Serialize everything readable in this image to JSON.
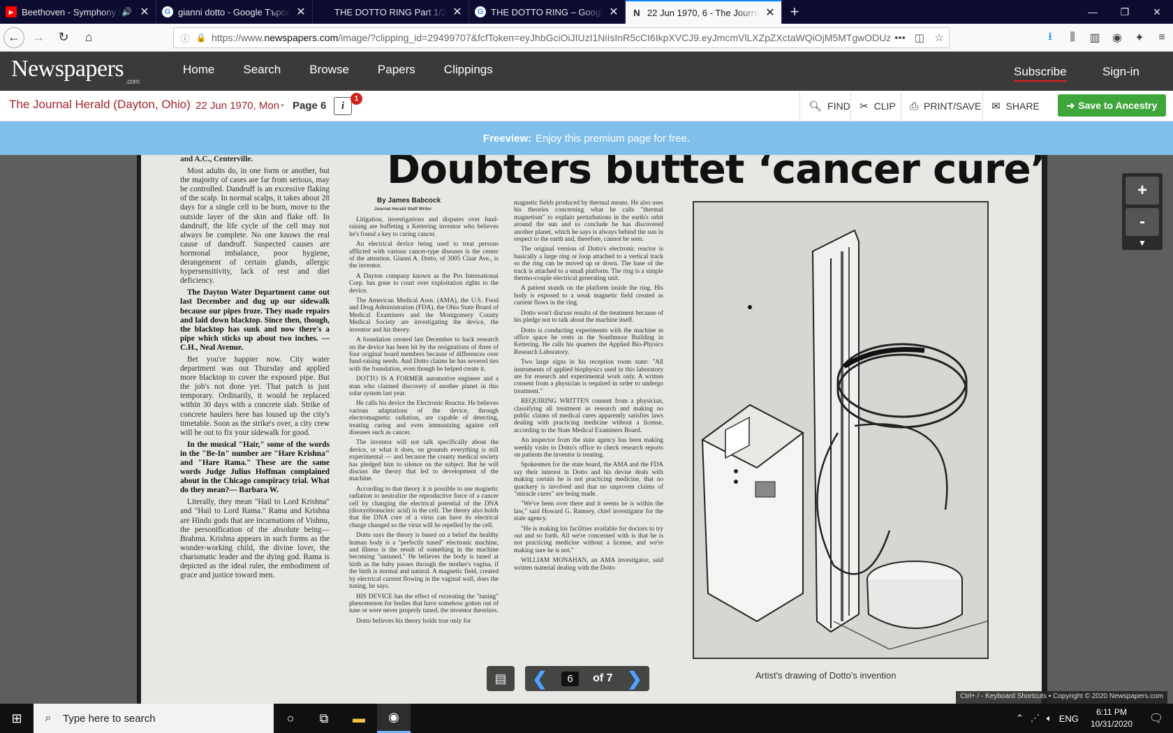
{
  "tabs": [
    {
      "title": "Beethoven - Symphony No.",
      "icon": "youtube-icon"
    },
    {
      "title": "gianni dotto - Google Търсене",
      "icon": "google-icon"
    },
    {
      "title": "THE DOTTO RING Part 1/2 - New",
      "icon": "tab-icon"
    },
    {
      "title": "THE DOTTO RING – Google Търс",
      "icon": "google-icon"
    },
    {
      "title": "22 Jun 1970, 6 - The Journal Her",
      "icon": "newspapers-icon"
    }
  ],
  "address": {
    "prefix": "https://www.",
    "domain": "newspapers.com",
    "path": "/image/?clipping_id=29499707&fcfToken=eyJhbGciOiJIUzI1NiIsInR5cCI6IkpXVCJ9.eyJmcmVlLXZpZXctaWQiOjM5MTgwODUzNy"
  },
  "site": {
    "logo": "Newspapers",
    "logo_suffix": ".com",
    "nav": [
      "Home",
      "Search",
      "Browse",
      "Papers",
      "Clippings"
    ],
    "subscribe": "Subscribe",
    "signin": "Sign-in"
  },
  "paper": {
    "name": "The Journal Herald (Dayton, Ohio)",
    "date": "22 Jun 1970, Mon",
    "page": "Page 6",
    "info_label": "i",
    "badge": "1",
    "find": "FIND",
    "clip": "CLIP",
    "print": "PRINT/SAVE",
    "share": "SHARE",
    "ancestry": "Save to Ancestry"
  },
  "freeview": {
    "label": "Freeview:",
    "text": "Enjoy this premium page for free."
  },
  "article": {
    "col1_top": "and A.C., Centerville.",
    "col1": [
      "Most adults do, in one form or another, but the majority of cases are far from serious, may be controlled. Dandruff is an excessive flaking of the scalp. In normal scalps, it takes about 28 days for a single cell to be born, move to the outside layer of the skin and flake off. In dandruff, the life cycle of the cell may not always be complete. No one knows the real cause of dandruff. Suspected causes are hormonal imbalance, poor hygiene, derangement of certain glands, allergic hypersensitivity, lack of rest and diet deficiency.",
      "The Dayton Water Department came out last December and dug up our sidewalk because our pipes froze. They made repairs and laid down blacktop. Since then, though, the blacktop has sunk and now there's a pipe which sticks up about two inches. — C.H., Neal Avenue.",
      "Bet you're happier now. City water department was out Thursday and applied more blacktop to cover the exposed pipe. But the job's not done yet. That patch is just temporary. Ordinarily, it would be replaced within 30 days with a concrete slab. Strike of concrete haulers here has loused up the city's timetable. Soon as the strike's over, a city crew will be out to fix your sidewalk for good.",
      "In the musical \"Hair,\" some of the words in the \"Be-In\" number are \"Hare Krishna\" and \"Hare Rama.\" These are the same words Judge Julius Hoffman complained about in the Chicago conspiracy trial. What do they mean?— Barbara W.",
      "Literally, they mean \"Hail to Lord Krishna\" and \"Hail to Lord Rama.\" Rama and Krishna are Hindu gods that are incarnations of Vishnu, the personification of the absolute being— Brahma. Krishna appears in such forms as the wonder-working child, the divine lover, the charismatic leader and the dying god. Rama is depicted as the ideal ruler, the embodiment of grace and justice toward men."
    ],
    "headline": "Doubters buttet ‘cancer cure’",
    "byline": "By James Babcock",
    "byline_title": "Journal Herald Staff Writer",
    "col2": [
      "Litigation, investigations and disputes over fund-raising are buffeting a Kettering inventor who believes he's found a key to curing cancer.",
      "An electrical device being used to treat persons afflicted with various cancer-type diseases is the center of the attention. Gianni A. Dotto, of 3005 Claar Ave., is the inventor.",
      "A Dayton company known as the Pro International Corp. has gone to court over exploitation rights to the device.",
      "The American Medical Assn. (AMA), the U.S. Food and Drug Administration (FDA), the Ohio State Board of Medical Examiners and the Montgomery County Medical Society are investigating the device, the inventor and his theory.",
      "A foundation created last December to back research on the device has been hit by the resignations of three of four original board members because of differences over fund-raising needs. And Dotto claims he has severed ties with the foundation, even though he helped create it.",
      "DOTTO IS A FORMER automotive engineer and a man who claimed discovery of another planet in this solar system last year.",
      "He calls his device the Electronic Reactor. He believes various adaptations of the device, through electromagnetic radiation, are capable of detecting, treating curing and even immunizing against cell diseases such as cancer.",
      "The inventor will not talk specifically about the device, or what it does, on grounds everything is still experimental — and because the county medical society has pledged him to silence on the subject. But he will discuss the theory that led to development of the machine.",
      "According to that theory it is possible to use magnetic radiation to neutralize the reproductive force of a cancer cell by changing the electrical potential of the DNA (dioxyribonucleic acid) in the cell. The theory also holds that the DNA core of a virus can have its electrical charge changed so the virus will be repelled by the cell.",
      "Dotto says the theory is based on a belief the healthy human body is a \"perfectly tuned\" electronic machine, and illness is the result of something in the machine becoming \"untuned.\" He believes the body is tuned at birth as the baby passes through the mother's vagina, if the birth is normal and natural. A magnetic field, created by electrical current flowing in the vaginal wall, does the tuning, he says.",
      "HIS DEVICE has the effect of recreating the \"tuning\" phenomenon for bodies that have somehow gotten out of tune or were never properly tuned, the inventor theorizes.",
      "Dotto believes his theory holds true only for"
    ],
    "col3": [
      "magnetic fields produced by thermal means. He also uses his theories concerning what he calls \"thermal magnetism\" to explain perturbations in the earth's orbit around the sun and to conclude he has discovered another planet, which he says is always behind the sun in respect to the earth and, therefore, cannot be seen.",
      "The original version of Dotto's electronic reactor is basically a large ring or loop attached to a vertical track so the ring can be moved up or down. The base of the track is attached to a small platform. The ring is a simple thermo-couple electrical generating unit.",
      "A patient stands on the platform inside the ring. His body is exposed to a weak magnetic field created as current flows in the ring.",
      "Dotto won't discuss results of the treatment because of his pledge not to talk about the machine itself.",
      "Dotto is conducting experiments with the machine in office space he rents in the Southmoor Building in Kettering. He calls his quarters the Applied Bio-Physics Research Laboratory.",
      "Two large signs in his reception room state: \"All instruments of applied biophysics used in this laboratory are for research and experimental work only. A written consent from a physician is required in order to undergo treatment.\"",
      "REQUIRING WRITTEN consent from a physician, classifying all treatment as research and making no public claims of medical cures apparently satisfies laws dealing with practicing medicine without a license, according to the State Medical Examiners Board.",
      "An inspector from the state agency has been making weekly visits to Dotto's office to check research reports on patients the inventor is treating.",
      "Spokesmen for the state board, the AMA and the FDA say their interest in Dotto and his devise deals with making certain he is not practicing medicine, that no quackery is involved and that no unproven claims of \"miracle cures\" are being made.",
      "\"We've been over there and it seems he is within the law,\" said Howard G. Ramsey, chief investigator for the state agency.",
      "\"He is making his facilities available for doctors to try out and so forth. All we're concerned with is that he is not practicing medicine without a license, and we're making sure he is not.\"",
      "WILLIAM MONAHAN, an AMA investigator, said written material dealing with the Dotto"
    ],
    "caption": "Artist's drawing of Dotto's invention"
  },
  "viewer": {
    "zoom_in": "+",
    "zoom_out": "-",
    "page_num": "6",
    "page_total": "of 7",
    "copyright": "Ctrl+ / - Keyboard Shortcuts • Copyright © 2020 Newspapers.com"
  },
  "taskbar": {
    "search_placeholder": "Type here to search",
    "lang": "ENG",
    "time": "6:11 PM",
    "date": "10/31/2020"
  }
}
